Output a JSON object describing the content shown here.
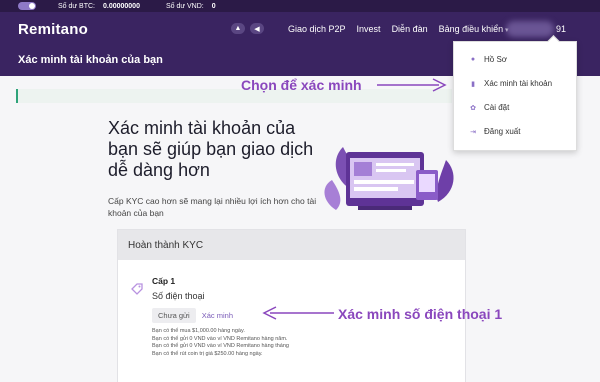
{
  "topbar": {
    "btc_label": "Số dư BTC:",
    "btc_value": "0.00000000",
    "vnd_label": "Số dư VND:",
    "vnd_value": "0"
  },
  "nav": {
    "logo": "Remitano",
    "links": [
      "Giao dịch P2P",
      "Invest",
      "Diễn đàn",
      "Bảng điều khiển"
    ],
    "tail": "91"
  },
  "page": {
    "title": "Xác minh tài khoản của bạn"
  },
  "main": {
    "heading": "Xác minh tài khoản của bạn sẽ giúp bạn giao dịch dễ dàng hơn",
    "description": "Cấp KYC cao hơn sẽ mang lại nhiều lợi ích hơn cho tài khoản của bạn"
  },
  "kyc": {
    "header": "Hoàn thành KYC",
    "level_title": "Cấp 1",
    "level_subtitle": "Số điện thoại",
    "pending_label": "Chưa gửi",
    "verify_label": "Xác minh",
    "notes": [
      "Bạn có thể mua $1,000.00 hàng ngày.",
      "Bạn có thể gửi 0 VND vào ví VND Remitano hàng năm.",
      "Bạn có thể gửi 0 VND vào ví VND Remitano hàng tháng",
      "Bạn có thể rút coin trị giá $250.00 hàng ngày."
    ]
  },
  "dropdown": {
    "items": [
      {
        "label": "Hồ Sơ",
        "icon": "user-icon"
      },
      {
        "label": "Xác minh tài khoản",
        "icon": "chart-icon"
      },
      {
        "label": "Cài đặt",
        "icon": "gear-icon"
      },
      {
        "label": "Đăng xuất",
        "icon": "logout-icon"
      }
    ]
  },
  "annotations": {
    "choose_verify": "Chọn để xác minh",
    "verify_phone": "Xác minh số điện thoại 1"
  },
  "colors": {
    "nav_bg": "#3a2461",
    "accent": "#8a47bd",
    "link_purple": "#7a5bb8"
  }
}
